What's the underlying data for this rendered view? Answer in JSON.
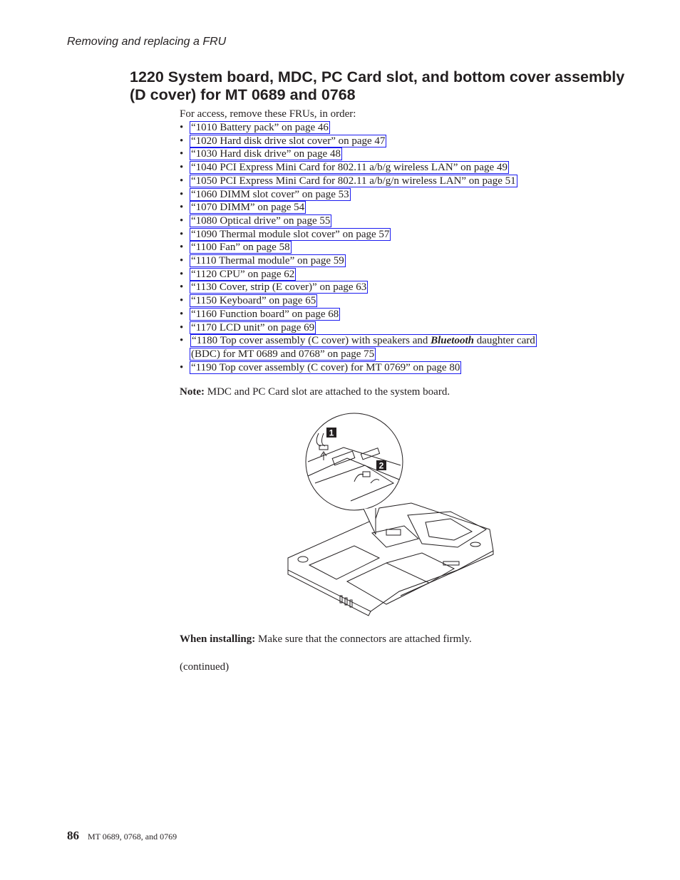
{
  "header": {
    "running_title": "Removing and replacing a FRU"
  },
  "section": {
    "title": "1220 System board, MDC, PC Card slot, and bottom cover assembly (D cover) for MT 0689 and 0768",
    "intro": "For access, remove these FRUs, in order:",
    "bullet": "•",
    "fru_links": [
      {
        "text": "“1010 Battery pack” on page 46"
      },
      {
        "text": "“1020 Hard disk drive slot cover” on page 47"
      },
      {
        "text": "“1030 Hard disk drive” on page 48"
      },
      {
        "text": "“1040 PCI Express Mini Card for 802.11 a/b/g wireless LAN” on page 49"
      },
      {
        "text": "“1050 PCI Express Mini Card for 802.11 a/b/g/n wireless LAN” on page 51"
      },
      {
        "text": "“1060 DIMM slot cover” on page 53"
      },
      {
        "text": "“1070 DIMM” on page 54"
      },
      {
        "text": "“1080 Optical drive” on page 55"
      },
      {
        "text": "“1090 Thermal module slot cover” on page 57"
      },
      {
        "text": "“1100 Fan” on page 58"
      },
      {
        "text": "“1110 Thermal module” on page 59"
      },
      {
        "text": "“1120 CPU” on page 62"
      },
      {
        "text": "“1130 Cover, strip (E cover)” on page 63"
      },
      {
        "text": "“1150 Keyboard” on page 65"
      },
      {
        "text": "“1160 Function board” on page 68"
      },
      {
        "text": "“1170 LCD unit” on page 69"
      }
    ],
    "fru_link_1180": {
      "part1": "“1180 Top cover assembly (C cover) with speakers and ",
      "italic": "Bluetooth",
      "part2": " daughter card",
      "line2": "(BDC) for MT 0689 and 0768” on page 75"
    },
    "fru_link_1190": {
      "text": "“1190 Top cover assembly (C cover) for MT 0769” on page 80"
    },
    "note": {
      "label": "Note:",
      "text": " MDC and PC Card slot are attached to the system board."
    },
    "figure": {
      "callouts": [
        "1",
        "2"
      ]
    },
    "install": {
      "label": "When installing:",
      "text": " Make sure that the connectors are attached firmly."
    },
    "continued": "(continued)"
  },
  "footer": {
    "page_number": "86",
    "text": "MT 0689, 0768, and 0769"
  },
  "colors": {
    "link_border": "#1b1bf0",
    "text": "#231f20"
  }
}
